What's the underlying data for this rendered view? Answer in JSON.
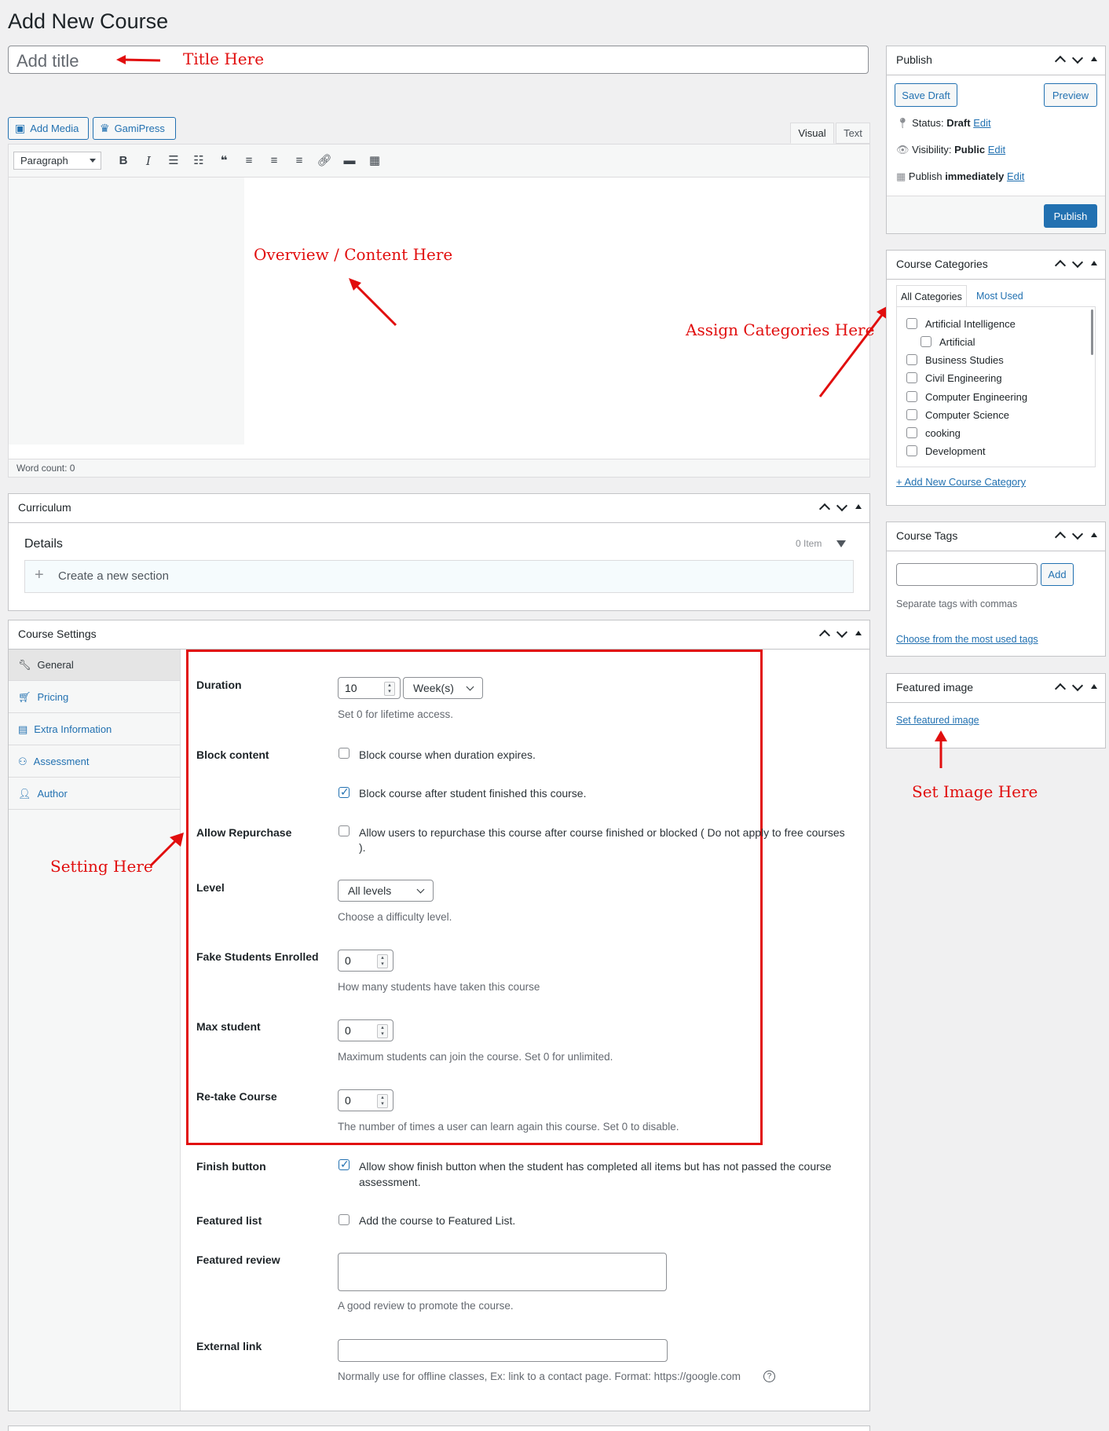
{
  "page": {
    "title": "Add New Course"
  },
  "title_input": {
    "placeholder": "Add title"
  },
  "annotations": {
    "title": "Title Here",
    "content": "Overview / Content Here",
    "categories": "Assign Categories Here",
    "image": "Set Image Here",
    "settings": "Setting Here"
  },
  "media_buttons": {
    "add_media": "Add Media",
    "gamipress": "GamiPress"
  },
  "editor": {
    "tabs": [
      "Visual",
      "Text"
    ],
    "format_select": "Paragraph",
    "toolbar_icons": [
      "bold-icon",
      "italic-icon",
      "bullet-list-icon",
      "numbered-list-icon",
      "blockquote-icon",
      "align-left-icon",
      "align-center-icon",
      "align-right-icon",
      "link-icon",
      "read-more-icon",
      "toolbar-toggle-icon"
    ],
    "word_count": "Word count: 0"
  },
  "curriculum": {
    "title": "Curriculum",
    "details": "Details",
    "item_count": "0 Item",
    "create_section": "Create a new section"
  },
  "course_settings": {
    "title": "Course Settings",
    "tabs": [
      {
        "label": "General",
        "icon": "wrench-icon"
      },
      {
        "label": "Pricing",
        "icon": "cart-icon"
      },
      {
        "label": "Extra Information",
        "icon": "list-icon"
      },
      {
        "label": "Assessment",
        "icon": "award-icon"
      },
      {
        "label": "Author",
        "icon": "user-icon"
      }
    ],
    "fields": {
      "duration": {
        "label": "Duration",
        "value": "10",
        "unit": "Week(s)",
        "desc": "Set 0 for lifetime access."
      },
      "block_content": {
        "label": "Block content",
        "opt1": "Block course when duration expires.",
        "opt1_checked": false,
        "opt2": "Block course after student finished this course.",
        "opt2_checked": true
      },
      "allow_repurchase": {
        "label": "Allow Repurchase",
        "opt": "Allow users to repurchase this course after course finished or blocked ( Do not apply to free courses",
        "opt_tail": ").",
        "checked": false
      },
      "level": {
        "label": "Level",
        "value": "All levels",
        "desc": "Choose a difficulty level."
      },
      "fake_students": {
        "label": "Fake Students Enrolled",
        "value": "0",
        "desc": "How many students have taken this course"
      },
      "max_student": {
        "label": "Max student",
        "value": "0",
        "desc": "Maximum students can join the course. Set 0 for unlimited."
      },
      "retake": {
        "label": "Re-take Course",
        "value": "0",
        "desc": "The number of times a user can learn again this course. Set 0 to disable."
      },
      "finish_button": {
        "label": "Finish button",
        "opt": "Allow show finish button when the student has completed all items but has not passed the course",
        "opt_tail": "assessment.",
        "checked": true
      },
      "featured_list": {
        "label": "Featured list",
        "opt": "Add the course to Featured List.",
        "checked": false
      },
      "featured_review": {
        "label": "Featured review",
        "value": "",
        "desc": "A good review to promote the course."
      },
      "external_link": {
        "label": "External link",
        "value": "",
        "desc": "Normally use for offline classes, Ex: link to a contact page. Format: https://google.com"
      }
    }
  },
  "publish": {
    "title": "Publish",
    "save_draft": "Save Draft",
    "preview": "Preview",
    "status_label": "Status:",
    "status_value": "Draft",
    "visibility_label": "Visibility:",
    "visibility_value": "Public",
    "publish_label": "Publish",
    "publish_value": "immediately",
    "edit": "Edit",
    "publish_button": "Publish"
  },
  "categories": {
    "title": "Course Categories",
    "tab_all": "All Categories",
    "tab_most": "Most Used",
    "items": [
      "Artificial Intelligence",
      "Artificial",
      "Business Studies",
      "Civil Engineering",
      "Computer Engineering",
      "Computer Science",
      "cooking",
      "Development"
    ],
    "add_new": "+ Add New Course Category"
  },
  "tags": {
    "title": "Course Tags",
    "add": "Add",
    "hint": "Separate tags with commas",
    "choose": "Choose from the most used tags"
  },
  "featured_image": {
    "title": "Featured image",
    "set": "Set featured image"
  },
  "colors": {
    "accent": "#2271b1",
    "annotation": "#e10e0e"
  }
}
